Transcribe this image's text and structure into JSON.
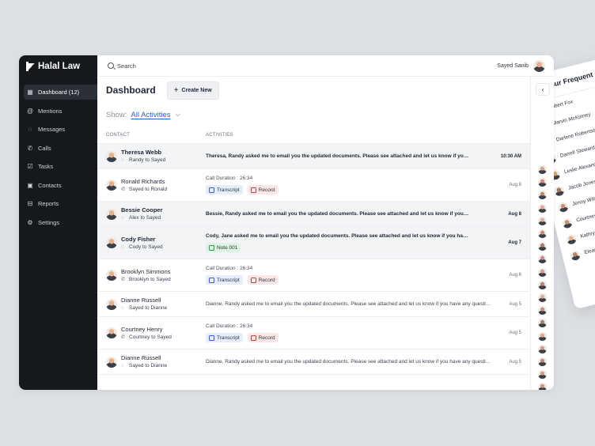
{
  "frequent_contacts": {
    "title": "Your Frequent Contacts",
    "arrow": "›",
    "names": [
      "Robert Fox",
      "Marvin McKinney",
      "Darlene Robertson",
      "Darrell Steward",
      "Leslie Alexander",
      "Jacob Jones",
      "Jenny Wilson",
      "Courtney Henry",
      "Kathryn Murphy",
      "Eleanor Pena"
    ],
    "avatar_colors": [
      "#d9a58a",
      "#c9706a",
      "#c7a38b",
      "#b98b6f",
      "#e0a15f",
      "#a27a60",
      "#d4917a",
      "#c49379",
      "#e3b08f",
      "#b7846d"
    ]
  },
  "app": {
    "name": "Halal Law"
  },
  "nav": [
    {
      "label": "Dashboard (12)",
      "icon": "grid-icon",
      "glyph": "▦",
      "active": true
    },
    {
      "label": "Mentions",
      "icon": "at-icon",
      "glyph": "@",
      "active": false
    },
    {
      "label": "Messages",
      "icon": "chat-icon",
      "glyph": "◌",
      "active": false
    },
    {
      "label": "Calls",
      "icon": "phone-icon",
      "glyph": "✆",
      "active": false
    },
    {
      "label": "Tasks",
      "icon": "tasks-icon",
      "glyph": "☑",
      "active": false
    },
    {
      "label": "Contacts",
      "icon": "contacts-icon",
      "glyph": "▣",
      "active": false
    },
    {
      "label": "Reports",
      "icon": "reports-icon",
      "glyph": "⊟",
      "active": false
    },
    {
      "label": "Settings",
      "icon": "gear-icon",
      "glyph": "⚙",
      "active": false
    }
  ],
  "topbar": {
    "search_label": "Search",
    "user_name": "Sayed Sanib"
  },
  "dashboard": {
    "title": "Dashboard",
    "create_label": "Create New",
    "create_glyph": "+"
  },
  "filter": {
    "show_label": "Show:",
    "selected": "All Activities",
    "chevron": "⌵"
  },
  "columns": {
    "contact": "CONTACT",
    "activities": "ACTIVITIES"
  },
  "right_panel": {
    "collapse_glyph": "‹",
    "avatar_colors": [
      "#c9a78f",
      "#d08a7e",
      "#b58a72",
      "#e3a8a0",
      "#d9b39a",
      "#c78f74",
      "#a97c65",
      "#c98c8c",
      "#d7a08a",
      "#b9876f",
      "#ddb197",
      "#c7937d",
      "#a8866f",
      "#e5a784",
      "#cba089",
      "#b88d74",
      "#d69c86",
      "#c79c7f"
    ]
  },
  "rows": [
    {
      "name": "Theresa Webb",
      "via": "Randy to Sayed",
      "via_icon": "chat-icon",
      "via_glyph": "◌",
      "type": "message",
      "message": "Theresa, Randy asked me to email you the updated documents. Please see attached and let us know if you have any questions.",
      "date": "10:30 AM",
      "unread": true,
      "selected": true
    },
    {
      "name": "Ronald Richards",
      "via": "Sayed to Ronald",
      "via_icon": "phone-icon",
      "via_glyph": "✆",
      "type": "call",
      "duration": "Call Duration : 26:34",
      "chips": [
        "Transcript",
        "Record"
      ],
      "date": "Aug 8",
      "unread": false,
      "selected": false
    },
    {
      "name": "Bessie Cooper",
      "via": "Alex to Sayed",
      "via_icon": "chat-icon",
      "via_glyph": "◌",
      "type": "message",
      "message": "Bessie, Randy asked me to email you the updated documents. Please see attached and let us know if you have any questions.",
      "date": "Aug 8",
      "unread": true,
      "selected": true
    },
    {
      "name": "Cody Fisher",
      "via": "Cody to Sayed",
      "via_icon": "chat-icon",
      "via_glyph": "◌",
      "type": "note",
      "message": "Cody, Jane asked me to email you the updated documents. Please see attached and let us know if you have any questions.",
      "note": "Note 001",
      "date": "Aug 7",
      "unread": true,
      "selected": true
    },
    {
      "name": "Brooklyn Simmons",
      "via": "Brooklyn to Sayed",
      "via_icon": "phone-icon",
      "via_glyph": "✆",
      "type": "call",
      "duration": "Call Duration : 26:34",
      "chips": [
        "Transcript",
        "Record"
      ],
      "date": "Aug 6",
      "unread": false,
      "selected": false
    },
    {
      "name": "Dianne Russell",
      "via": "Sayed to Dianne",
      "via_icon": "chat-icon",
      "via_glyph": "◌",
      "type": "message",
      "message": "Dianne, Randy asked me to email you the updated documents. Please see attached and let us know if you have any questions.",
      "date": "Aug 5",
      "unread": false,
      "selected": false
    },
    {
      "name": "Courtney Henry",
      "via": "Courtney to Sayed",
      "via_icon": "phone-icon",
      "via_glyph": "✆",
      "type": "call",
      "duration": "Call Duration : 26:34",
      "chips": [
        "Transcript",
        "Record"
      ],
      "date": "Aug 5",
      "unread": false,
      "selected": false
    },
    {
      "name": "Dianne Russell",
      "via": "Sayed to Dianne",
      "via_icon": "chat-icon",
      "via_glyph": "◌",
      "type": "message",
      "message": "Dianne, Randy asked me to email you the updated documents. Please see attached and let us know if you have any questions.",
      "date": "Aug 5",
      "unread": false,
      "selected": false
    }
  ]
}
